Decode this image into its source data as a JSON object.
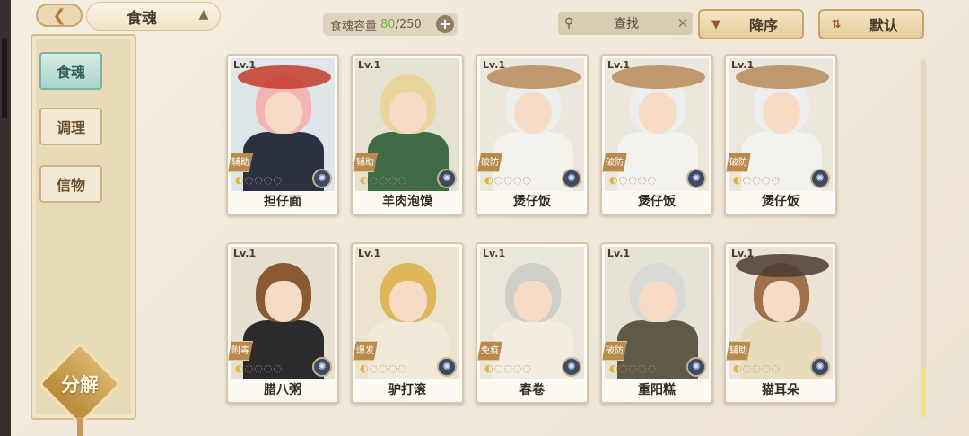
{
  "header": {
    "back_icon": "chevron-left-icon",
    "title": "食魂",
    "capacity_label": "食魂容量",
    "capacity_current": "80",
    "capacity_total": "/250",
    "plus_label": "+",
    "search_label": "查找",
    "sort_label": "降序",
    "default_label": "默认"
  },
  "sidebar": {
    "tabs": [
      {
        "label": "食魂",
        "active": true
      },
      {
        "label": "调理",
        "active": false
      },
      {
        "label": "信物",
        "active": false
      }
    ],
    "decompose_label": "分解"
  },
  "cards": [
    {
      "level": "Lv.1",
      "role": "辅助",
      "name": "担仔面"
    },
    {
      "level": "Lv.1",
      "role": "辅助",
      "name": "羊肉泡馍"
    },
    {
      "level": "Lv.1",
      "role": "破防",
      "name": "煲仔饭"
    },
    {
      "level": "Lv.1",
      "role": "破防",
      "name": "煲仔饭"
    },
    {
      "level": "Lv.1",
      "role": "破防",
      "name": "煲仔饭"
    },
    {
      "level": "Lv.1",
      "role": "附毒",
      "name": "腊八粥"
    },
    {
      "level": "Lv.1",
      "role": "爆发",
      "name": "驴打滚"
    },
    {
      "level": "Lv.1",
      "role": "免疫",
      "name": "春卷"
    },
    {
      "level": "Lv.1",
      "role": "破防",
      "name": "重阳糕"
    },
    {
      "level": "Lv.1",
      "role": "辅助",
      "name": "猫耳朵"
    }
  ],
  "colors": {
    "accent_gold": "#c8a568",
    "active_tab": "#a9d4c9",
    "capacity_current": "#6fb23b"
  }
}
